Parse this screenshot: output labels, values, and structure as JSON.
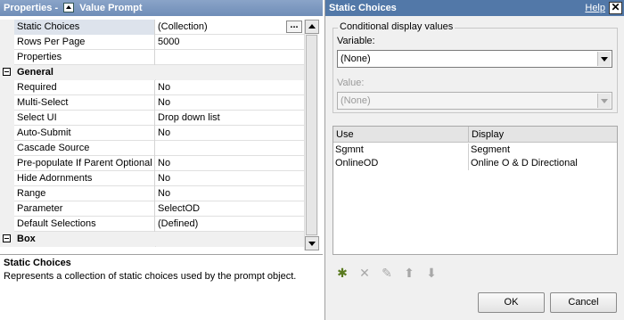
{
  "properties_panel": {
    "title_prefix": "Properties -",
    "title_object": "Value Prompt",
    "rows": [
      {
        "name": "Static Choices",
        "value": "(Collection)",
        "selected": true,
        "has_button": true
      },
      {
        "name": "Rows Per Page",
        "value": "5000"
      },
      {
        "name": "Properties",
        "value": ""
      },
      {
        "group": true,
        "name": "General"
      },
      {
        "name": "Required",
        "value": "No"
      },
      {
        "name": "Multi-Select",
        "value": "No"
      },
      {
        "name": "Select UI",
        "value": "Drop down list"
      },
      {
        "name": "Auto-Submit",
        "value": "No"
      },
      {
        "name": "Cascade Source",
        "value": ""
      },
      {
        "name": "Pre-populate If Parent Optional",
        "value": "No"
      },
      {
        "name": "Hide Adornments",
        "value": "No"
      },
      {
        "name": "Range",
        "value": "No"
      },
      {
        "name": "Parameter",
        "value": "SelectOD"
      },
      {
        "name": "Default Selections",
        "value": "(Defined)"
      },
      {
        "group": true,
        "name": "Box"
      }
    ],
    "ellipsis_label": "...",
    "description": {
      "title": "Static Choices",
      "text": "Represents a collection of static choices used by the prompt object."
    }
  },
  "dialog": {
    "title": "Static Choices",
    "help_label": "Help",
    "close_label": "✕",
    "conditional_group_label": "Conditional display values",
    "variable_label": "Variable:",
    "variable_value": "(None)",
    "value_label": "Value:",
    "value_value": "(None)",
    "table": {
      "headers": [
        "Use",
        "Display"
      ],
      "rows": [
        [
          "Sgmnt",
          "Segment"
        ],
        [
          "OnlineOD",
          "Online O & D Directional"
        ]
      ]
    },
    "toolbar": [
      {
        "icon": "new-item-icon",
        "glyph": "✱",
        "enabled": true
      },
      {
        "icon": "delete-icon",
        "glyph": "✕",
        "enabled": false
      },
      {
        "icon": "edit-icon",
        "glyph": "✎",
        "enabled": false
      },
      {
        "icon": "move-up-icon",
        "glyph": "⬆",
        "enabled": false
      },
      {
        "icon": "move-down-icon",
        "glyph": "⬇",
        "enabled": false
      }
    ],
    "ok_label": "OK",
    "cancel_label": "Cancel"
  }
}
